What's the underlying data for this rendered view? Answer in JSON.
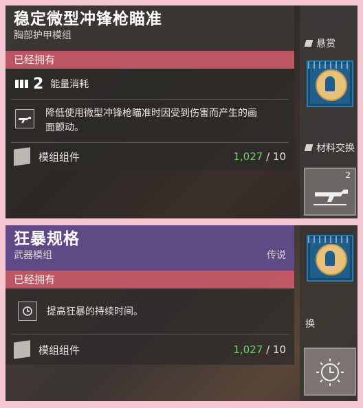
{
  "top_card": {
    "title": "稳定微型冲锋枪瞄准",
    "subtitle": "胸部护甲模组",
    "status": "已经拥有",
    "energy_value": "2",
    "energy_label": "能量消耗",
    "description": "降低使用微型冲锋枪瞄准时因受到伤害而产生的画面颤动。",
    "component_label": "模组组件",
    "component_owned": "1,027",
    "component_cost": "/ 10"
  },
  "bottom_card": {
    "title": "狂暴规格",
    "subtitle": "武器模组",
    "rarity": "传说",
    "status": "已经拥有",
    "description": "提高狂暴的持续时间。",
    "component_label": "模组组件",
    "component_owned": "1,027",
    "component_cost": "/ 10"
  },
  "side": {
    "tab_bounty": "悬赏",
    "tab_exchange": "材料交换",
    "reward_count": "2",
    "tab_exchange_partial": "换"
  },
  "colors": {
    "owned_bar": "#c95a68",
    "legendary_header": "#5f4a86",
    "owned_count": "#6ed26a"
  }
}
